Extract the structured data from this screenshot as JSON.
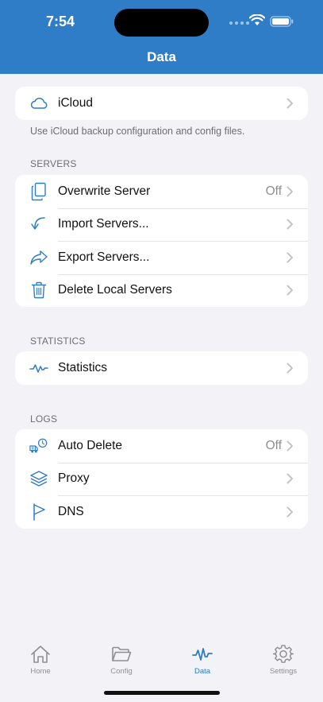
{
  "status_bar": {
    "time": "7:54"
  },
  "nav": {
    "title": "Data"
  },
  "icloud": {
    "label": "iCloud",
    "footnote": "Use iCloud backup configuration and config files."
  },
  "servers": {
    "header": "SERVERS",
    "rows": [
      {
        "label": "Overwrite Server",
        "value": "Off",
        "icon": "copy-icon"
      },
      {
        "label": "Import Servers...",
        "icon": "import-icon"
      },
      {
        "label": "Export Servers...",
        "icon": "share-icon"
      },
      {
        "label": "Delete Local Servers",
        "icon": "trash-icon"
      }
    ]
  },
  "statistics": {
    "header": "STATISTICS",
    "rows": [
      {
        "label": "Statistics",
        "icon": "waveform-icon"
      }
    ]
  },
  "logs": {
    "header": "LOGS",
    "rows": [
      {
        "label": "Auto Delete",
        "value": "Off",
        "icon": "truck-clock-icon"
      },
      {
        "label": "Proxy",
        "icon": "layers-icon"
      },
      {
        "label": "DNS",
        "icon": "flag-icon"
      }
    ]
  },
  "tabs": [
    {
      "label": "Home",
      "icon": "home-icon"
    },
    {
      "label": "Config",
      "icon": "folder-icon"
    },
    {
      "label": "Data",
      "icon": "waveform-icon",
      "active": true
    },
    {
      "label": "Settings",
      "icon": "gear-icon"
    }
  ],
  "colors": {
    "accent": "#2f7cc7",
    "background": "#f2f2f7",
    "secondary_text": "#8e8e93"
  }
}
